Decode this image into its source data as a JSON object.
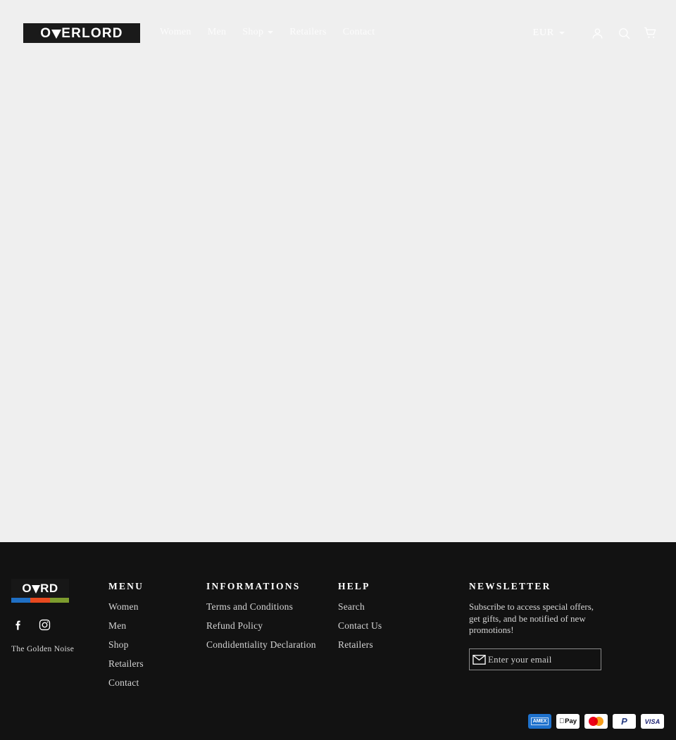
{
  "header": {
    "logo": {
      "text": "OVERLORD",
      "pre": "O",
      "post": "ERLORD"
    },
    "nav": [
      {
        "label": "Women",
        "has_caret": false
      },
      {
        "label": "Men",
        "has_caret": false
      },
      {
        "label": "Shop",
        "has_caret": true
      },
      {
        "label": "Retailers",
        "has_caret": false
      },
      {
        "label": "Contact",
        "has_caret": false
      }
    ],
    "currency": {
      "value": "EUR",
      "icon": "chevron-down-icon"
    },
    "icons": [
      {
        "name": "account-icon",
        "title": "Log in"
      },
      {
        "name": "search-icon",
        "title": "Search"
      },
      {
        "name": "cart-icon",
        "title": "Cart"
      }
    ]
  },
  "footer": {
    "brand": {
      "logo_pre": "O",
      "logo_post": "RD",
      "bar_colors": [
        "#1f6fc4",
        "#e8491f",
        "#7d9c2e"
      ],
      "tagline": "The Golden Noise",
      "socials": [
        {
          "name": "facebook-icon",
          "label": "Facebook"
        },
        {
          "name": "instagram-icon",
          "label": "Instagram"
        }
      ]
    },
    "columns": [
      {
        "title": "MENU",
        "links": [
          "Women",
          "Men",
          "Shop",
          "Retailers",
          "Contact"
        ]
      },
      {
        "title": "INFORMATIONS",
        "links": [
          "Terms and Conditions",
          "Refund Policy",
          "Condidentiality Declaration"
        ]
      },
      {
        "title": "HELP",
        "links": [
          "Search",
          "Contact Us",
          "Retailers"
        ]
      }
    ],
    "newsletter": {
      "title": "NEWSLETTER",
      "description": "Subscribe to access special offers, get gifts, and be notified of new promotions!",
      "placeholder": "Enter your email",
      "value": "",
      "submit_icon": "envelope-icon"
    },
    "payments": [
      {
        "name": "american-express",
        "label": "AMEX"
      },
      {
        "name": "apple-pay",
        "label": "Pay"
      },
      {
        "name": "mastercard",
        "label": "Mastercard"
      },
      {
        "name": "paypal",
        "label": "P"
      },
      {
        "name": "visa",
        "label": "VISA"
      }
    ]
  },
  "colors": {
    "page_background": "#efefef",
    "footer_background": "#121212",
    "logo_background": "#1a1a1a",
    "text_light": "#d5d5d5",
    "text_white": "#ffffff"
  }
}
